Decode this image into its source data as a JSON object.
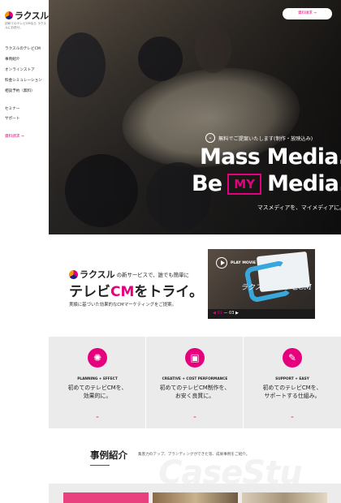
{
  "brand": {
    "logo_text": "ラクスル",
    "tagline": "初めてのテレビCMなら ラクスルにお任せ。",
    "accent_color": "#e6007e"
  },
  "sidebar": {
    "items": [
      {
        "label": "ラクスルのテレビCM"
      },
      {
        "label": "事例紹介"
      },
      {
        "label": "オンラインストア"
      },
      {
        "label": "料金シミュレーション"
      },
      {
        "label": "相談予約（無料）"
      },
      {
        "label": "セミナー"
      },
      {
        "label": "サポート"
      }
    ],
    "cta_label": "資料請求 →"
  },
  "hero": {
    "request_button": "資料請求 →",
    "free_icon": "chevron-down-icon",
    "free_text": "無料でご提案いたします(制作・放映込み)",
    "line1": "Mass Media.",
    "line2_pre": "Be",
    "line2_box": "MY",
    "line2_post": "Media.",
    "subtitle": "マスメディアを、マイメディアに。"
  },
  "intro": {
    "brand": "ラクスル",
    "lead": "の新サービスで、誰でも簡単に",
    "headline_pre": "テレビ",
    "headline_accent": "CM",
    "headline_post": "をトライ。",
    "sub": "実績に基づいた効果的なCMマーケティングをご提案。"
  },
  "video": {
    "play_label": "PLAY MOVIE",
    "script_text": "ラクスルのテレビCM",
    "page_current": "01",
    "page_total": "03"
  },
  "features": [
    {
      "icon": "lightbulb-icon",
      "label": "PLANNING + EFFECT",
      "title_line1": "初めてのテレビCMを、",
      "title_line2": "効果的に。"
    },
    {
      "icon": "tv-icon",
      "label": "CREATIVE + COST PERFORMANCE",
      "title_line1": "初めてのテレビCM制作を、",
      "title_line2": "お安く良質に。"
    },
    {
      "icon": "pencil-icon",
      "label": "SUPPORT + EASY",
      "title_line1": "初めてのテレビCMを、",
      "title_line2": "サポートする仕組み。"
    }
  ],
  "cases": {
    "title": "事例紹介",
    "description": "集客力のアップ、ブランディングができた等、成果事例をご紹介。",
    "bg_text": "CaseStu"
  }
}
